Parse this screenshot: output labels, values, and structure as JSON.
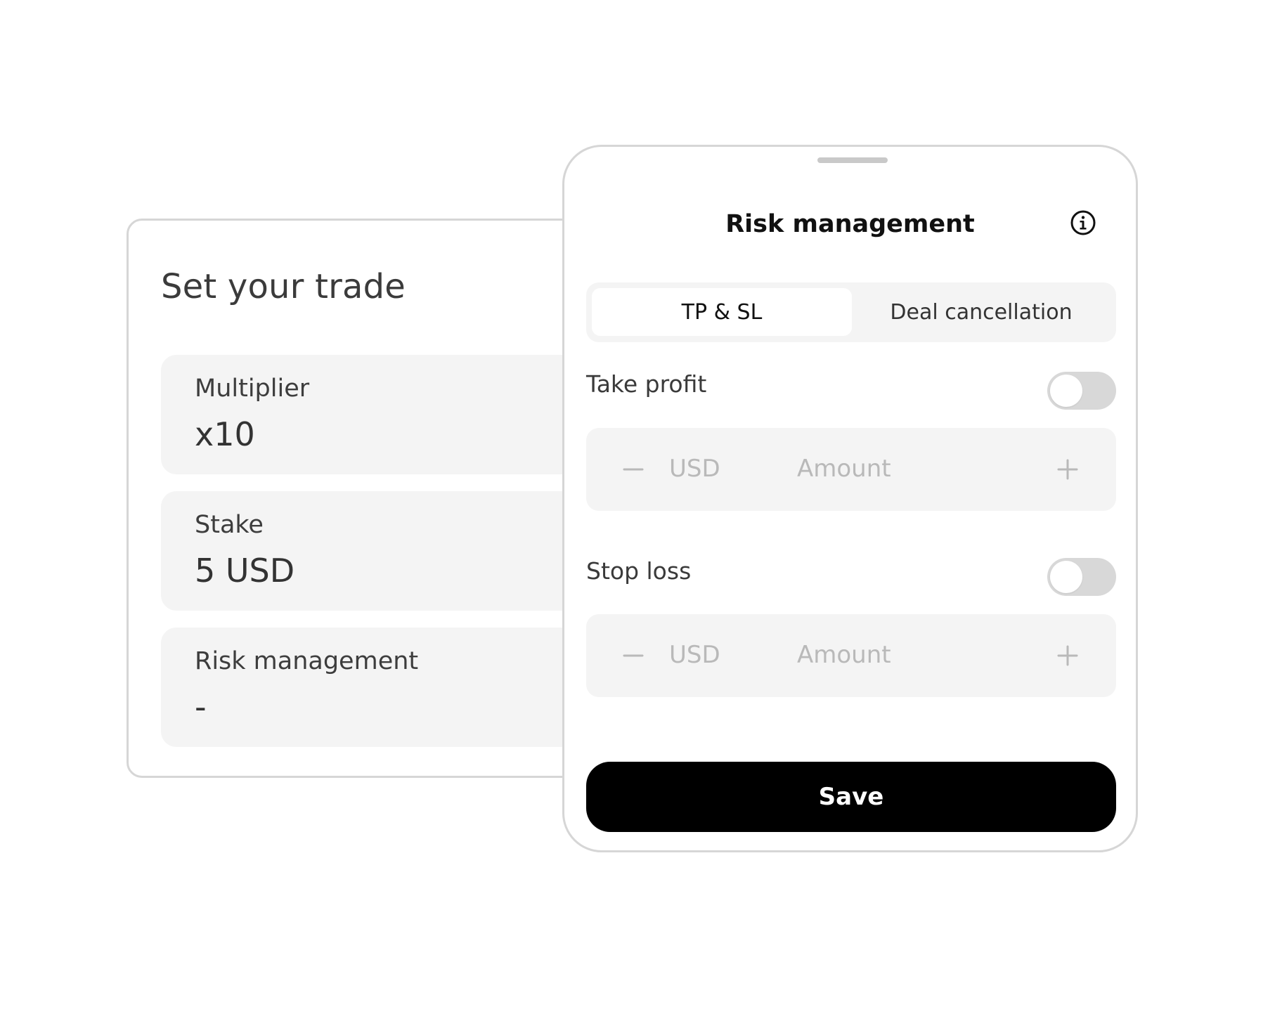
{
  "trade_card": {
    "title": "Set your trade",
    "fields": [
      {
        "label": "Multiplier",
        "value": "x10"
      },
      {
        "label": "Stake",
        "value": "5 USD"
      },
      {
        "label": "Risk management",
        "value": "-"
      }
    ]
  },
  "risk_sheet": {
    "title": "Risk management",
    "info_icon": "info-circle-icon",
    "tabs": [
      {
        "label": "TP & SL",
        "active": true
      },
      {
        "label": "Deal cancellation",
        "active": false
      }
    ],
    "take_profit": {
      "label": "Take profit",
      "enabled": false,
      "currency": "USD",
      "amount_placeholder": "Amount",
      "amount_value": ""
    },
    "stop_loss": {
      "label": "Stop loss",
      "enabled": false,
      "currency": "USD",
      "amount_placeholder": "Amount",
      "amount_value": ""
    },
    "save_label": "Save"
  },
  "colors": {
    "panel_bg": "#f4f4f4",
    "border": "#d6d6d6",
    "toggle_off": "#d8d8d8",
    "muted_text": "#b9b9b9",
    "primary_button": "#000000"
  }
}
